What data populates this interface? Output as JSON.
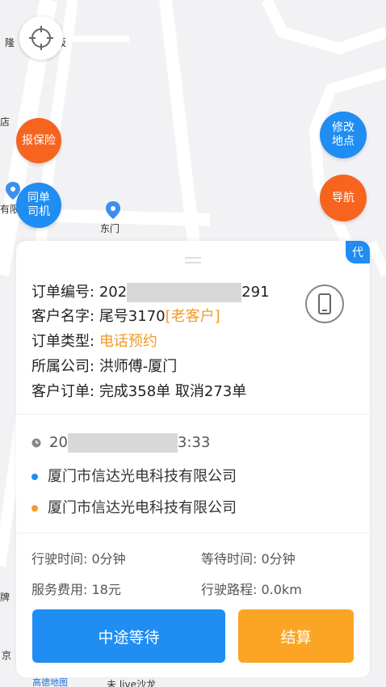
{
  "map": {
    "labels": {
      "long": "隆",
      "ban": "坂",
      "dian": "店",
      "you": "有限",
      "dongmen": "东门",
      "pai": "牌",
      "jing": "京",
      "bottom_brand": "高德地图",
      "bottom_poi": "未 live沙龙"
    },
    "buttons": {
      "insurance": "报保险",
      "same_driver": "同单\n司机",
      "modify_location": "修改\n地点",
      "navigate": "导航"
    }
  },
  "card": {
    "tag": "代",
    "order": {
      "order_no_label": "订单编号:",
      "order_no_prefix": "202",
      "order_no_suffix": "291",
      "customer_label": "客户名字:",
      "customer_value": "尾号3170",
      "customer_tag": "[老客户]",
      "type_label": "订单类型:",
      "type_value": "电话预约",
      "company_label": "所属公司:",
      "company_value": "洪师傅-厦门",
      "history_label": "客户订单:",
      "history_value": "完成358单  取消273单"
    },
    "route": {
      "time_prefix": "20",
      "time_suffix": "3:33",
      "start": "厦门市信达光电科技有限公司",
      "end": "厦门市信达光电科技有限公司",
      "start_color": "#1f8df2",
      "end_color": "#fb9a25"
    },
    "stats": {
      "drive_time": "行驶时间: 0分钟",
      "wait_time": "等待时间: 0分钟",
      "fee": "服务费用: 18元",
      "distance": "行驶路程: 0.0km"
    },
    "actions": {
      "wait": "中途等待",
      "settle": "结算"
    }
  }
}
